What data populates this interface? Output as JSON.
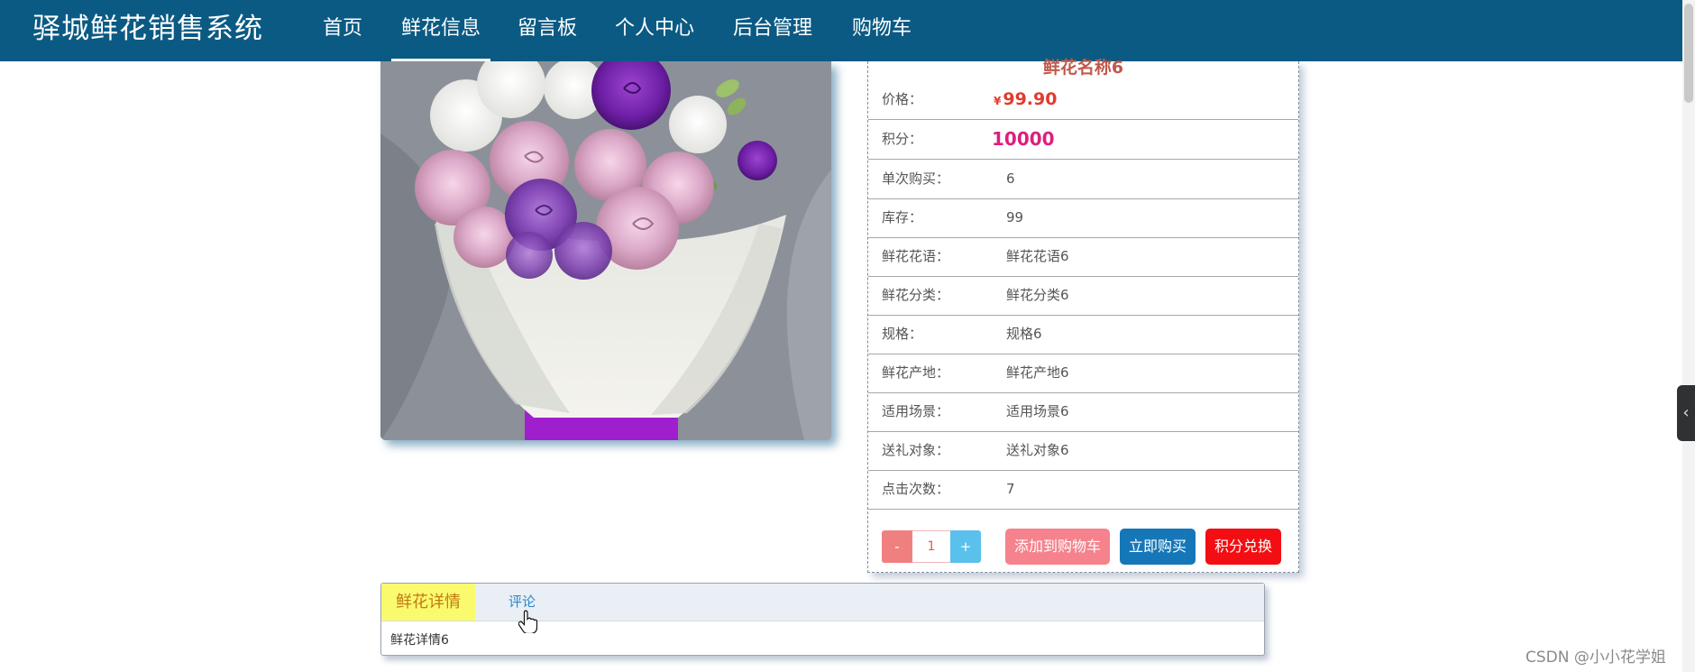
{
  "header": {
    "brand": "驿城鲜花销售系统",
    "nav": [
      {
        "label": "首页",
        "active": false
      },
      {
        "label": "鲜花信息",
        "active": true
      },
      {
        "label": "留言板",
        "active": false
      },
      {
        "label": "个人中心",
        "active": false
      },
      {
        "label": "后台管理",
        "active": false
      },
      {
        "label": "购物车",
        "active": false
      }
    ]
  },
  "product": {
    "name": "鲜花名称6",
    "price": {
      "label": "价格：",
      "currency": "¥",
      "value": "99.90"
    },
    "points": {
      "label": "积分：",
      "value": "10000"
    },
    "rows": [
      {
        "label": "单次购买：",
        "value": "6"
      },
      {
        "label": "库存：",
        "value": "99"
      },
      {
        "label": "鲜花花语：",
        "value": "鲜花花语6"
      },
      {
        "label": "鲜花分类：",
        "value": "鲜花分类6"
      },
      {
        "label": "规格：",
        "value": "规格6"
      },
      {
        "label": "鲜花产地：",
        "value": "鲜花产地6"
      },
      {
        "label": "适用场景：",
        "value": "适用场景6"
      },
      {
        "label": "送礼对象：",
        "value": "送礼对象6"
      },
      {
        "label": "点击次数：",
        "value": "7"
      }
    ],
    "quantity": {
      "minus": "-",
      "value": "1",
      "plus": "+"
    },
    "actions": {
      "add_to_cart": "添加到购物车",
      "buy_now": "立即购买",
      "points_exchange": "积分兑换"
    }
  },
  "tabs": {
    "detail_label": "鲜花详情",
    "comment_label": "评论",
    "content": "鲜花详情6"
  },
  "watermark": "CSDN @小小花学姐",
  "colors": {
    "nav_bg": "#0b5a83",
    "price": "#e23b2f",
    "points": "#dd1f7f",
    "buy_button": "#1677b8",
    "exchange_button": "#f40d12",
    "cart_button": "#f5828c"
  },
  "icons": {
    "side_toggle": "chevron-left-icon",
    "pointer": "hand-pointer-icon"
  }
}
